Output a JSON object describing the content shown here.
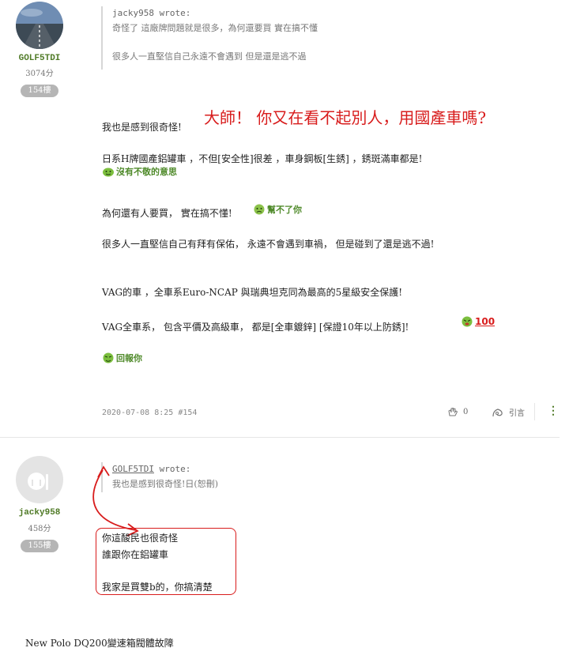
{
  "post154": {
    "author": {
      "name": "GOLF5TDI",
      "points": "3074分",
      "floor": "154樓"
    },
    "quote": {
      "who": "jacky958 wrote:",
      "line1": "奇怪了  這廠牌問題就是很多，為何還要買  實在搞不懂",
      "line2": "很多人一直堅信自己永遠不會遇到  但是還是逃不過"
    },
    "annotation": "大師！ 你又在看不起別人，用國產車嗎?",
    "lines": {
      "l1": "我也是感到很奇怪!",
      "l2": "日系H牌國產鋁罐車 ，不但[安全性]很差 ，車身鋼板[生銹] ，銹斑滿車都是!",
      "l2_emoji": "沒有不敬的意思",
      "l3": "為何還有人要買，  實在搞不懂!",
      "l3_emoji": "幫不了你",
      "l4": "很多人一直堅信自己有拜有保佑， 永遠不會遇到車禍， 但是碰到了還是逃不過!",
      "l5": "VAG的車 ，全車系Euro-NCAP 與瑞典坦克同為最高的5星級安全保護!",
      "l6": "VAG全車系， 包含平價及高級車， 都是[全車鍍鋅] [保證10年以上防銹]!",
      "l6_badge": "100",
      "l7_emoji": "回報你"
    },
    "meta": "2020-07-08 8:25 #154",
    "likes": "0",
    "cite": "引言",
    "more": "⋮"
  },
  "post155": {
    "author": {
      "name": "jacky958",
      "points": "458分",
      "floor": "155樓"
    },
    "quote": {
      "who_name": "GOLF5TDI",
      "who_suffix": " wrote:",
      "line1": "我也是感到很奇怪!日(恕刪)"
    },
    "lines": {
      "l1": "你這酸民也很奇怪",
      "l2": "誰跟你在鋁罐車",
      "l3": "我家是買雙b的，你搞清楚"
    }
  },
  "footer": {
    "title": "New Polo DQ200變速箱閥體故障"
  },
  "colors": {
    "accent": "#4f7a26",
    "annotation": "#d81c1c"
  }
}
